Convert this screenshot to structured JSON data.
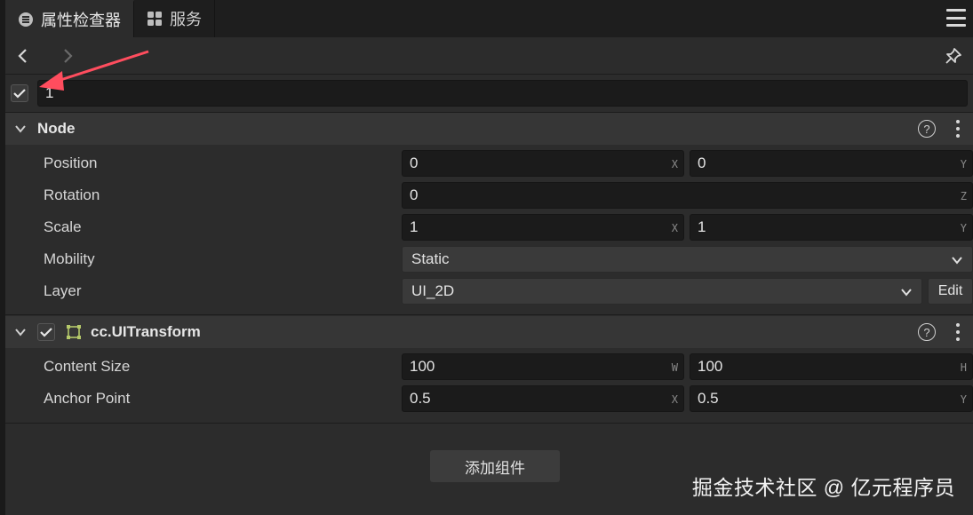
{
  "tabs": [
    {
      "label": "属性检查器",
      "icon": "inspector-icon"
    },
    {
      "label": "服务",
      "icon": "grid-icon"
    }
  ],
  "node_name": "1",
  "node_section": {
    "title": "Node",
    "position": {
      "label": "Position",
      "x": "0",
      "y": "0"
    },
    "rotation": {
      "label": "Rotation",
      "z": "0"
    },
    "scale": {
      "label": "Scale",
      "x": "1",
      "y": "1"
    },
    "mobility": {
      "label": "Mobility",
      "value": "Static"
    },
    "layer": {
      "label": "Layer",
      "value": "UI_2D",
      "edit": "Edit"
    }
  },
  "ui_transform": {
    "title": "cc.UITransform",
    "content_size": {
      "label": "Content Size",
      "w": "100",
      "h": "100"
    },
    "anchor_point": {
      "label": "Anchor Point",
      "x": "0.5",
      "y": "0.5"
    }
  },
  "units": {
    "x": "X",
    "y": "Y",
    "z": "Z",
    "w": "W",
    "h": "H"
  },
  "help_glyph": "?",
  "add_component": "添加组件",
  "watermark": "掘金技术社区 @ 亿元程序员",
  "colors": {
    "arrow": "#ff4d5e",
    "background": "#2c2c2c",
    "field": "#1b1b1b"
  }
}
